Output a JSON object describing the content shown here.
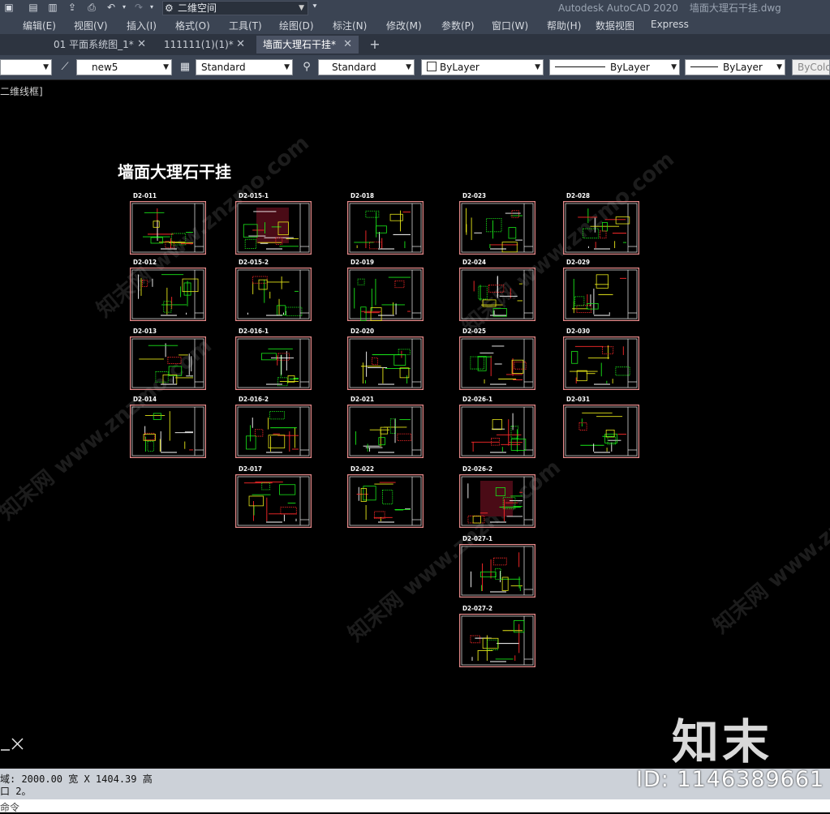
{
  "app": {
    "title": "Autodesk AutoCAD 2020",
    "filename": "墙面大理石干挂.dwg",
    "workspace": "二维空间"
  },
  "menu": [
    "编辑(E)",
    "视图(V)",
    "插入(I)",
    "格式(O)",
    "工具(T)",
    "绘图(D)",
    "标注(N)",
    "修改(M)",
    "参数(P)",
    "窗口(W)",
    "帮助(H)",
    "数据视图",
    "Express"
  ],
  "tabs": [
    {
      "label": "01 平面系统图_1*"
    },
    {
      "label": "111111(1)(1)*"
    },
    {
      "label": "墙面大理石干挂*",
      "active": true
    }
  ],
  "properties": {
    "layer": "new5",
    "text_style": "Standard",
    "dim_style": "Standard",
    "color": "ByLayer",
    "linetype": "ByLayer",
    "lineweight": "ByLayer",
    "plotstyle": "ByColo"
  },
  "viewport_label": "二维线框]",
  "drawing": {
    "title": "墙面大理石干挂",
    "sheets": [
      "D2-011",
      "D2-012",
      "D2-013",
      "D2-014",
      "D2-015-1",
      "D2-015-2",
      "D2-016-1",
      "D2-016-2",
      "D2-017",
      "D2-018",
      "D2-019",
      "D2-020",
      "D2-021",
      "D2-022",
      "D2-023",
      "D2-024",
      "D2-025",
      "D2-026-1",
      "D2-026-2",
      "D2-027-1",
      "D2-027-2",
      "D2-028",
      "D2-029",
      "D2-030",
      "D2-031"
    ]
  },
  "command": {
    "line1": "域:  2000.00 宽 X 1404.39 高",
    "line2": "口 2。",
    "prompt": "命令"
  },
  "watermarks": {
    "site": "知末网 www.znzmo.com",
    "logo": "知末",
    "id": "ID: 1146389661"
  },
  "colors": {
    "sheet_frame": "#e58a8a",
    "line_green": "#19e619",
    "line_red": "#ff2a2a",
    "line_yellow": "#e6e619"
  }
}
